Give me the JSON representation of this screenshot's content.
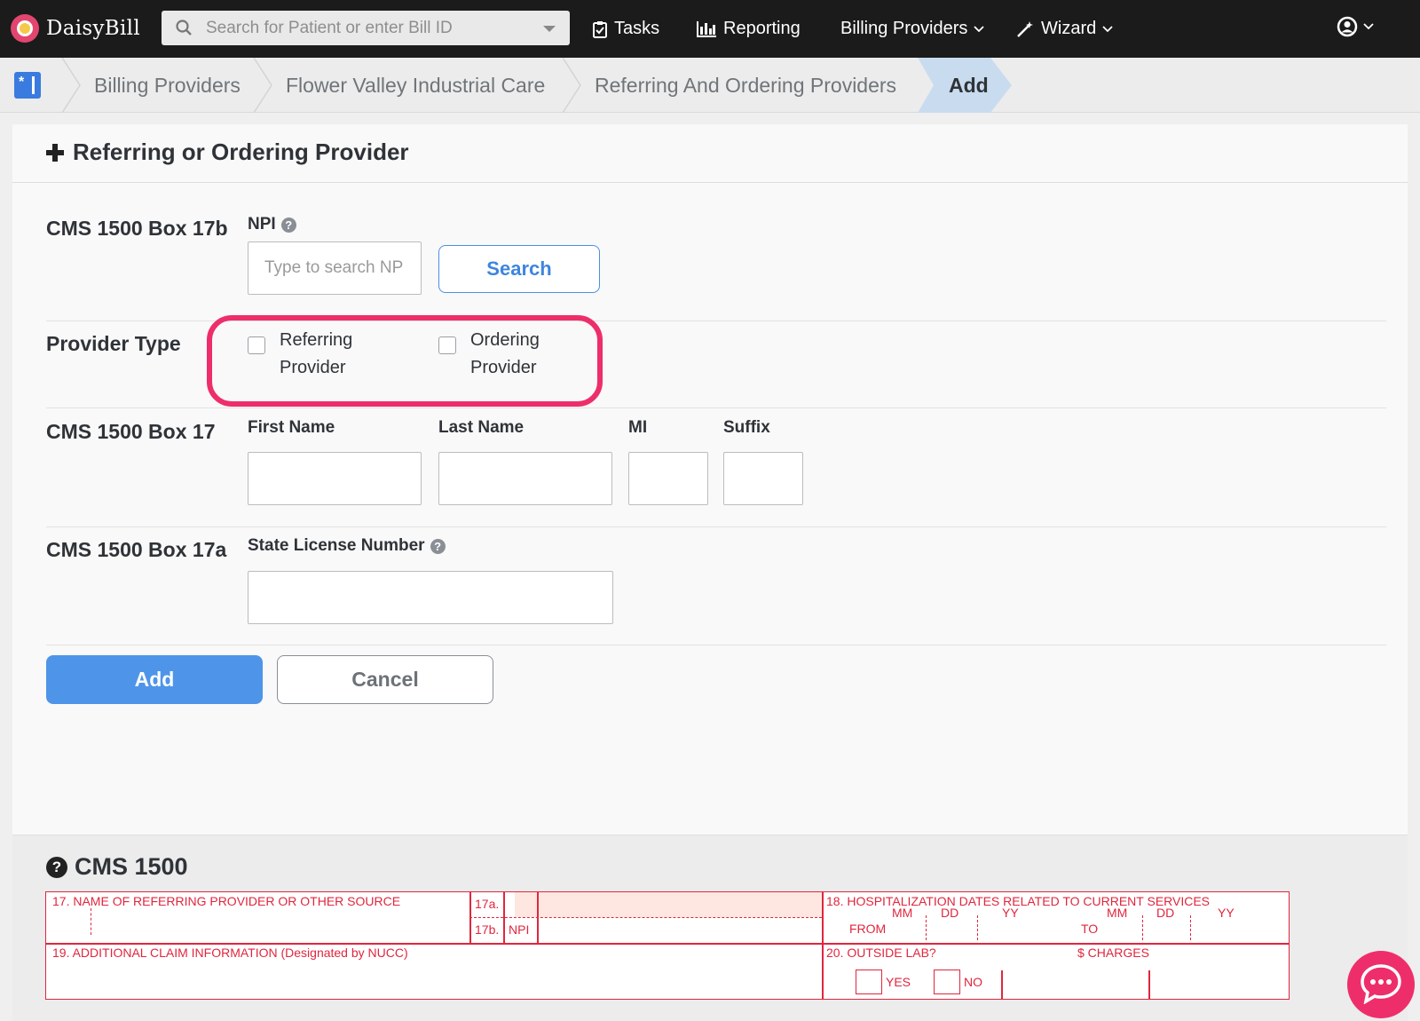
{
  "app": {
    "brand": "DaisyBill",
    "search_placeholder": "Search for Patient or enter Bill ID"
  },
  "nav": {
    "tasks": "Tasks",
    "reporting": "Reporting",
    "billing_providers": "Billing Providers",
    "wizard": "Wizard"
  },
  "breadcrumb": {
    "items": [
      "Billing Providers",
      "Flower Valley Industrial Care",
      "Referring And Ordering Providers"
    ],
    "active": "Add"
  },
  "form": {
    "title": "Referring or Ordering Provider",
    "box17b": {
      "label": "CMS 1500 Box 17b",
      "npi_label": "NPI",
      "npi_placeholder": "Type to search NPI",
      "npi_value": "",
      "search_button": "Search"
    },
    "provider_type": {
      "label": "Provider Type",
      "options": [
        {
          "line1": "Referring",
          "line2": "Provider",
          "checked": false
        },
        {
          "line1": "Ordering",
          "line2": "Provider",
          "checked": false
        }
      ]
    },
    "box17": {
      "label": "CMS 1500 Box 17",
      "first_name_label": "First Name",
      "last_name_label": "Last Name",
      "mi_label": "MI",
      "suffix_label": "Suffix",
      "first_name_value": "",
      "last_name_value": "",
      "mi_value": "",
      "suffix_value": ""
    },
    "box17a": {
      "label": "CMS 1500 Box 17a",
      "state_license_label": "State License Number",
      "state_license_value": ""
    },
    "add_button": "Add",
    "cancel_button": "Cancel"
  },
  "cms1500": {
    "title": "CMS 1500",
    "box17": "17. NAME OF REFERRING PROVIDER OR OTHER SOURCE",
    "box17a": "17a.",
    "box17b": "17b.",
    "npi": "NPI",
    "box18": "18. HOSPITALIZATION DATES RELATED TO CURRENT SERVICES",
    "mm": "MM",
    "dd": "DD",
    "yy": "YY",
    "from": "FROM",
    "to": "TO",
    "box19": "19. ADDITIONAL CLAIM INFORMATION (Designated by NUCC)",
    "box20": "20. OUTSIDE LAB?",
    "charges": "$ CHARGES",
    "yes": "YES",
    "no": "NO"
  },
  "colors": {
    "accent": "#4e95e9",
    "highlight": "#ee2e6a",
    "form_red": "#e0263e",
    "nav_bg": "#1b1b1b"
  }
}
